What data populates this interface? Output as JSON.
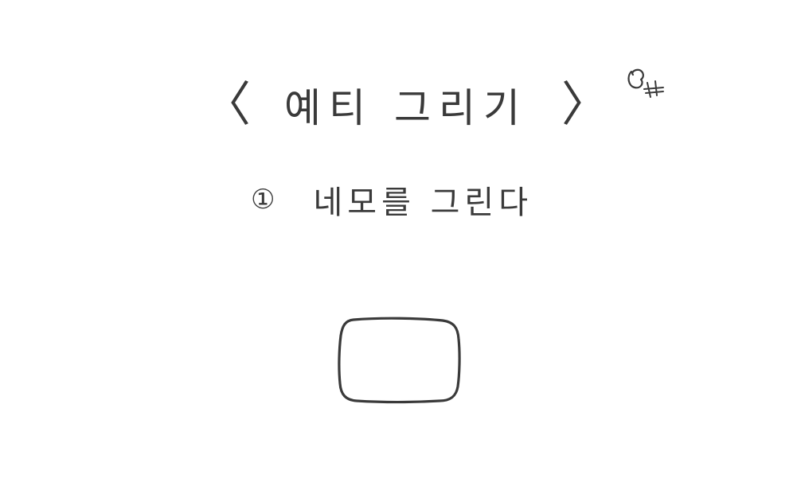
{
  "title": {
    "left_bracket": "〈",
    "text": "예티 그리기",
    "right_bracket": "〉"
  },
  "signature": {
    "icon": "handwritten-signature"
  },
  "step": {
    "number": "①",
    "text": "네모를 그린다"
  },
  "illustration": {
    "shape": "rounded-rectangle",
    "stroke_color": "#3a3a3a"
  }
}
